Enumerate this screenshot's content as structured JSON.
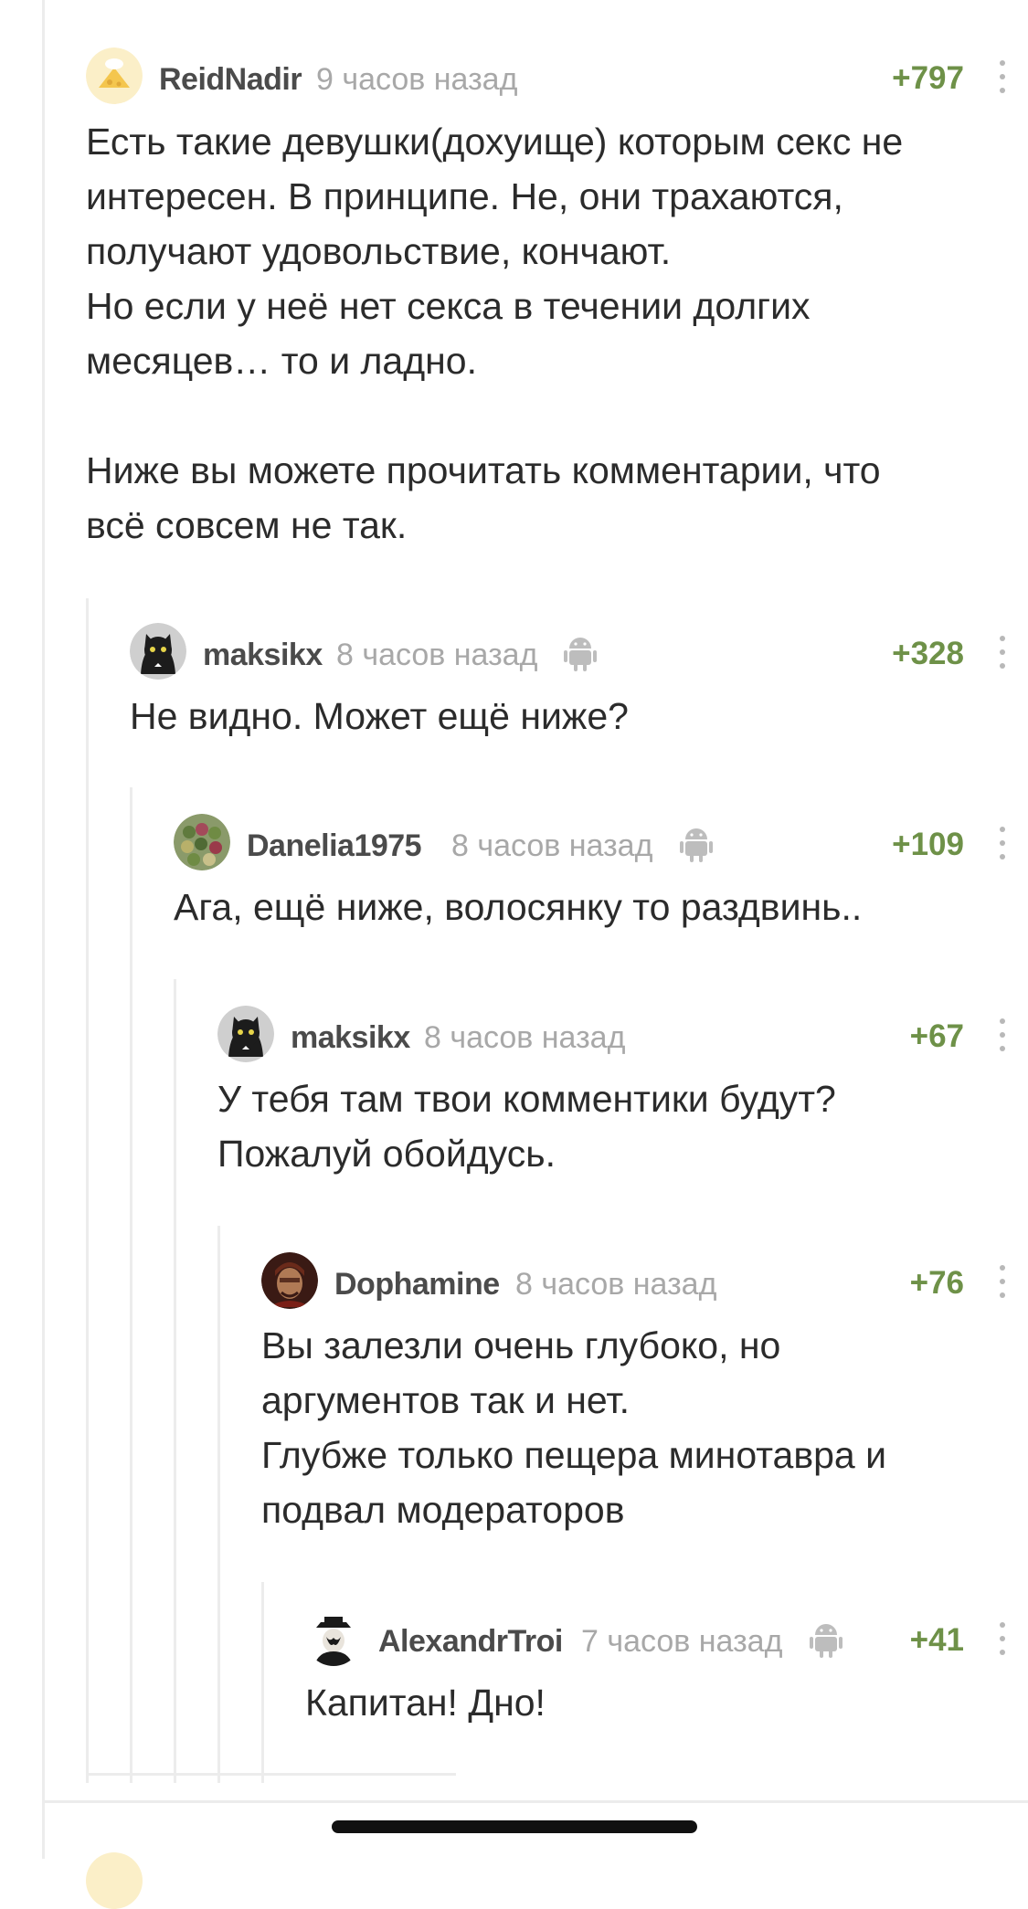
{
  "comments": [
    {
      "author": "ReidNadir",
      "time": "9 часов назад",
      "rating": "+797",
      "avatar_icon": "cheese-chef-icon",
      "has_android": false,
      "lines": [
        "Есть такие девушки(дохуище) которым секс не",
        "интересен. В принципе. Не, они трахаются,",
        "получают удовольствие, кончают.",
        "Но если у неё нет секса в течении долгих",
        "месяцев… то и ладно.",
        "",
        "Ниже вы можете прочитать комментарии, что",
        "всё совсем не так."
      ]
    },
    {
      "author": "maksikx",
      "time": "8 часов назад",
      "rating": "+328",
      "avatar_icon": "black-cat-icon",
      "has_android": true,
      "lines": [
        "Не видно. Может ещё ниже?"
      ]
    },
    {
      "author": "Danelia1975",
      "time": "8 часов назад",
      "rating": "+109",
      "avatar_icon": "cacti-icon",
      "has_android": true,
      "lines": [
        "Ага, ещё ниже, волосянку то раздвинь.."
      ]
    },
    {
      "author": "maksikx",
      "time": "8 часов назад",
      "rating": "+67",
      "avatar_icon": "black-cat-icon",
      "has_android": false,
      "lines": [
        "У тебя там твои комментики будут?",
        "Пожалуй обойдусь."
      ]
    },
    {
      "author": "Dophamine",
      "time": "8 часов назад",
      "rating": "+76",
      "avatar_icon": "warrior-portrait-icon",
      "has_android": false,
      "lines": [
        "Вы залезли очень глубоко, но",
        "аргументов так и нет.",
        "Глубже только пещера минотавра и",
        "подвал модераторов"
      ]
    },
    {
      "author": "AlexandrTroi",
      "time": "7 часов назад",
      "rating": "+41",
      "avatar_icon": "masked-detective-icon",
      "has_android": true,
      "lines": [
        "Капитан! Дно!"
      ]
    }
  ],
  "colors": {
    "rating": "#6e9148",
    "author": "#4b4b4b",
    "time": "#a8a8a8",
    "thread_line": "#ececec"
  }
}
